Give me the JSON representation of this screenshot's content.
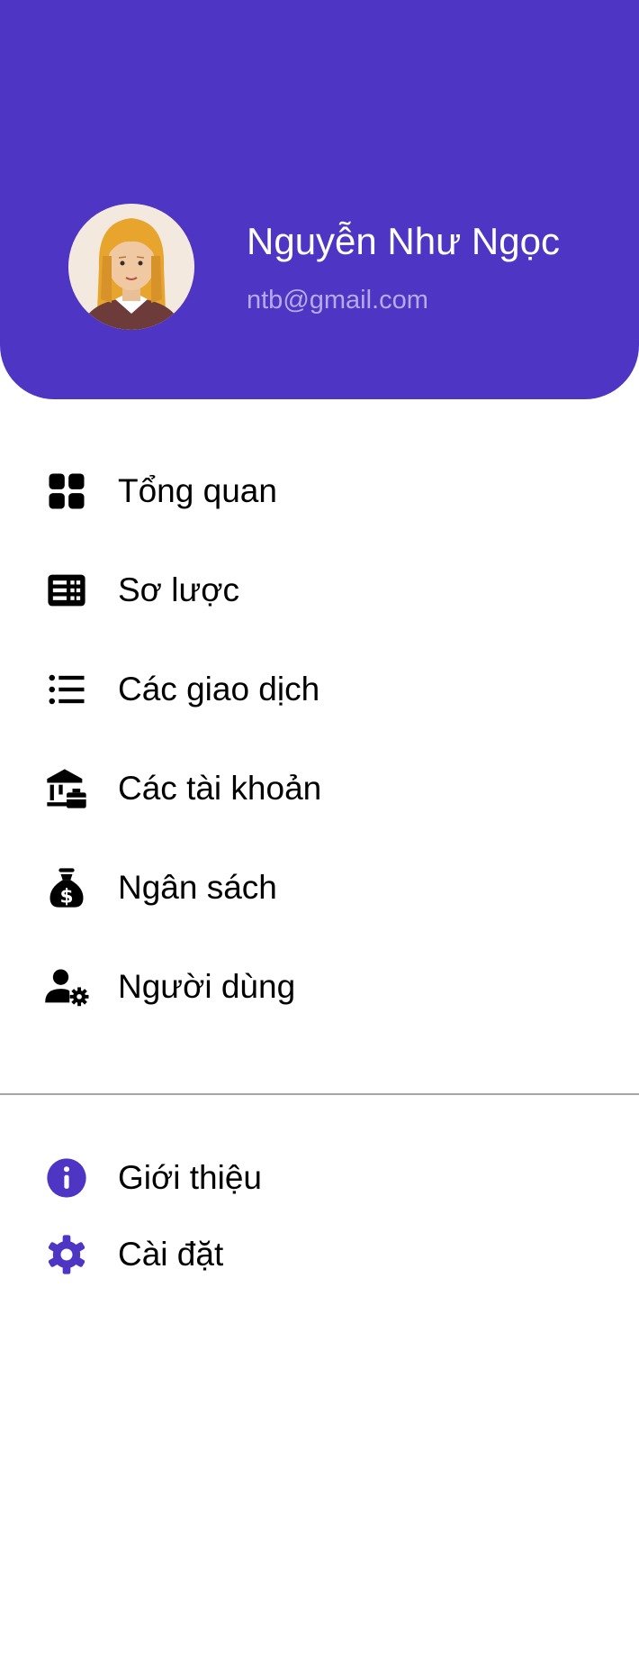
{
  "profile": {
    "name": "Nguyễn Như Ngọc",
    "email": "ntb@gmail.com",
    "header_color": "#4f35c4"
  },
  "menu": {
    "items": [
      {
        "label": "Tổng quan",
        "icon": "dashboard-icon"
      },
      {
        "label": "Sơ lược",
        "icon": "article-icon"
      },
      {
        "label": "Các giao dịch",
        "icon": "list-icon"
      },
      {
        "label": "Các tài khoản",
        "icon": "bank-icon"
      },
      {
        "label": "Ngân sách",
        "icon": "money-bag-icon"
      },
      {
        "label": "Người dùng",
        "icon": "user-settings-icon"
      }
    ],
    "secondary": [
      {
        "label": "Giới thiệu",
        "icon": "info-icon",
        "icon_color": "#4f35c4"
      },
      {
        "label": "Cài đặt",
        "icon": "settings-gear-icon",
        "icon_color": "#4f35c4"
      }
    ]
  }
}
